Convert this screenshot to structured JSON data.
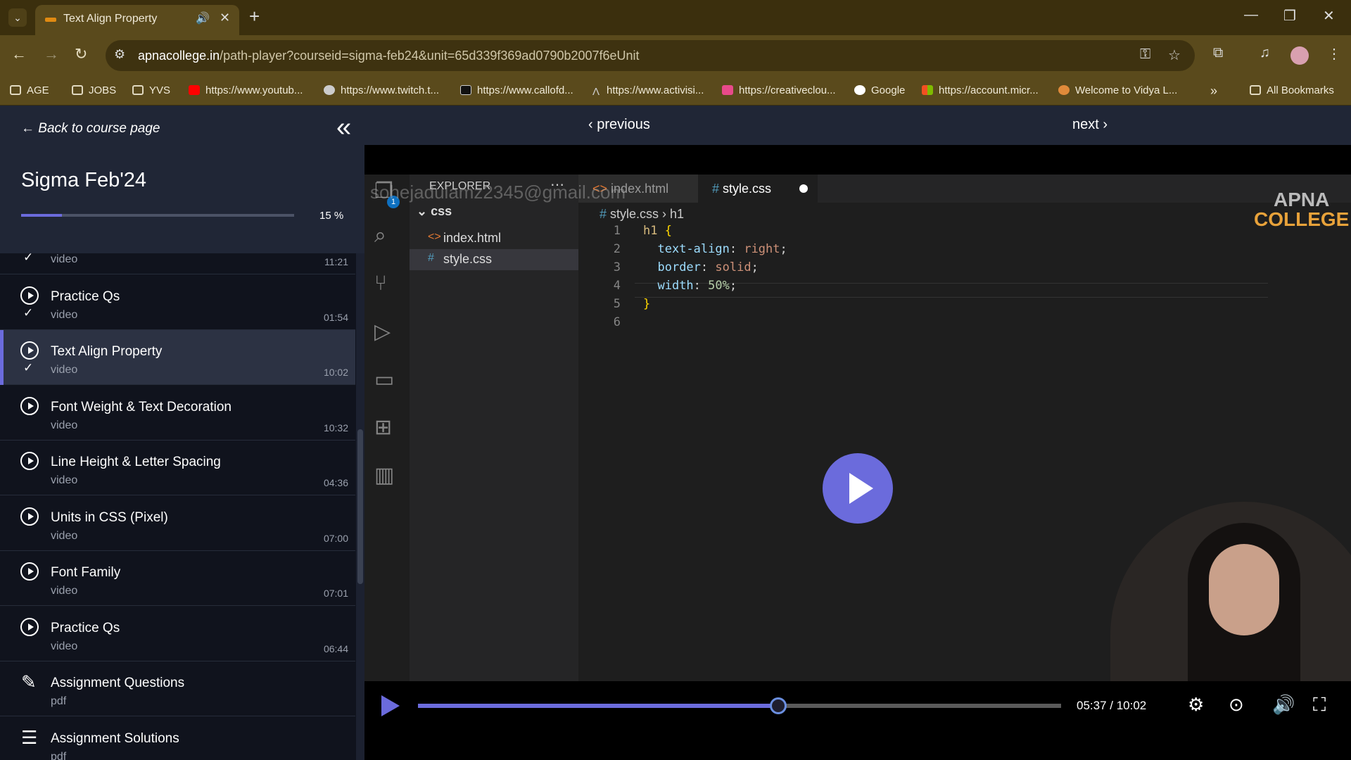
{
  "browser": {
    "tab_title": "Text Align Property",
    "url_host": "apnacollege.in",
    "url_path": "/path-player?courseid=sigma-feb24&unit=65d339f369ad0790b2007f6eUnit",
    "bookmarks": [
      {
        "label": "AGE",
        "icon": "folder-icon"
      },
      {
        "label": "JOBS",
        "icon": "folder-icon"
      },
      {
        "label": "YVS",
        "icon": "folder-icon"
      },
      {
        "label": "https://www.youtub...",
        "icon": "youtube-icon"
      },
      {
        "label": "https://www.twitch.t...",
        "icon": "globe-icon"
      },
      {
        "label": "https://www.callofd...",
        "icon": "cod-icon"
      },
      {
        "label": "https://www.activisi...",
        "icon": "activision-icon"
      },
      {
        "label": "https://creativeclou...",
        "icon": "creative-cloud-icon"
      },
      {
        "label": "Google",
        "icon": "google-icon"
      },
      {
        "label": "https://account.micr...",
        "icon": "microsoft-icon"
      },
      {
        "label": "Welcome to Vidya L...",
        "icon": "vidya-icon"
      }
    ],
    "all_bookmarks": "All Bookmarks"
  },
  "sidebar": {
    "back_label": "Back to course page",
    "course_title": "Sigma Feb'24",
    "progress_percent": 15,
    "progress_label": "15 %",
    "items": [
      {
        "title": "",
        "type": "video",
        "duration": "11:21",
        "icon": "play",
        "checked": true,
        "active": false
      },
      {
        "title": "Practice Qs",
        "type": "video",
        "duration": "01:54",
        "icon": "play",
        "checked": true,
        "active": false
      },
      {
        "title": "Text Align Property",
        "type": "video",
        "duration": "10:02",
        "icon": "play",
        "checked": true,
        "active": true
      },
      {
        "title": "Font Weight & Text Decoration",
        "type": "video",
        "duration": "10:32",
        "icon": "play",
        "checked": false,
        "active": false
      },
      {
        "title": "Line Height & Letter Spacing",
        "type": "video",
        "duration": "04:36",
        "icon": "play",
        "checked": false,
        "active": false
      },
      {
        "title": "Units in CSS (Pixel)",
        "type": "video",
        "duration": "07:00",
        "icon": "play",
        "checked": false,
        "active": false
      },
      {
        "title": "Font Family",
        "type": "video",
        "duration": "07:01",
        "icon": "play",
        "checked": false,
        "active": false
      },
      {
        "title": "Practice Qs",
        "type": "video",
        "duration": "06:44",
        "icon": "play",
        "checked": false,
        "active": false
      },
      {
        "title": "Assignment Questions",
        "type": "pdf",
        "duration": "",
        "icon": "assignment",
        "checked": false,
        "active": false
      },
      {
        "title": "Assignment Solutions",
        "type": "pdf",
        "duration": "",
        "icon": "checklist",
        "checked": false,
        "active": false
      }
    ]
  },
  "nav": {
    "previous": "previous",
    "next": "next"
  },
  "vscode": {
    "explorer_title": "EXPLORER",
    "badge": "1",
    "folder": "css",
    "files": [
      "index.html",
      "style.css"
    ],
    "watermark_email": "sohejadulamz2345@gmail.com",
    "tabs": [
      "index.html",
      "style.css"
    ],
    "breadcrumb": [
      "style.css",
      "h1"
    ],
    "lines": [
      "1",
      "2",
      "3",
      "4",
      "5",
      "6"
    ],
    "code": {
      "l1_sel": "h1",
      "l1_brace": "{",
      "l2_prop": "text-align",
      "l2_val": "right",
      "l3_prop": "border",
      "l3_val": "solid",
      "l4_prop": "width",
      "l4_val": "50%",
      "l5_brace": "}"
    },
    "logo_top": "APNA",
    "logo_bottom": "COLLEGE"
  },
  "player": {
    "time": "05:37 / 10:02",
    "progress_fraction": 0.56
  }
}
